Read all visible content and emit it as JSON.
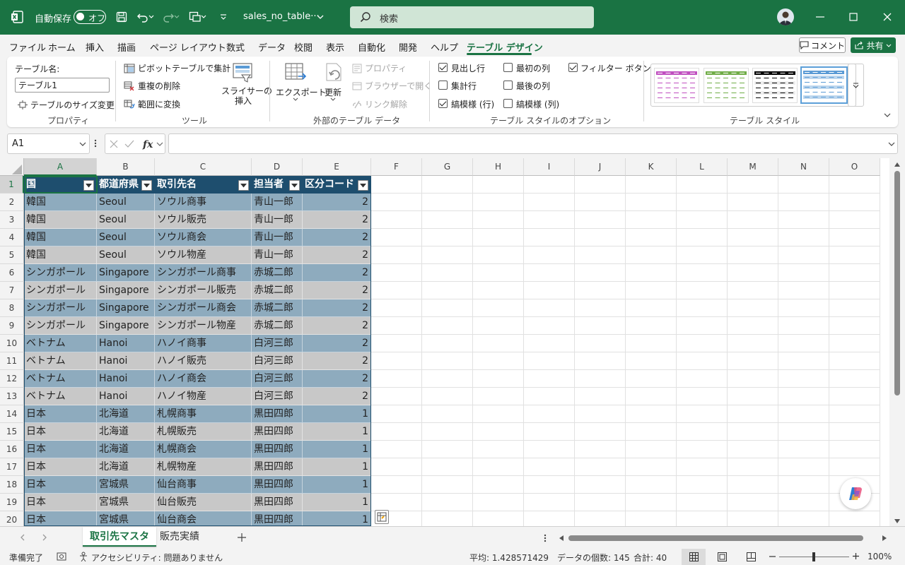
{
  "titlebar": {
    "autosave_label": "自動保存",
    "autosave_state": "オフ",
    "filename": "sales_no_table···",
    "search_placeholder": "検索"
  },
  "menu": [
    "ファイル",
    "ホーム",
    "挿入",
    "描画",
    "ページ レイアウト",
    "数式",
    "データ",
    "校閲",
    "表示",
    "自動化",
    "開発",
    "ヘルプ",
    "テーブル デザイン"
  ],
  "menu_active": "テーブル デザイン",
  "actions": {
    "comment": "コメント",
    "share": "共有"
  },
  "ribbon": {
    "table_name_label": "テーブル名:",
    "table_name_value": "テーブル1",
    "resize_table": "テーブルのサイズ変更",
    "group_properties": "プロパティ",
    "pivot_summary": "ピボットテーブルで集計",
    "remove_duplicates": "重複の削除",
    "convert_to_range": "範囲に変換",
    "slicer_line1": "スライサーの",
    "slicer_line2": "挿入",
    "group_tools": "ツール",
    "export": "エクスポート",
    "refresh": "更新",
    "properties": "プロパティ",
    "open_in_browser": "ブラウザーで開く",
    "unlink": "リンク解除",
    "group_external": "外部のテーブル データ",
    "opt_header_row": "見出し行",
    "opt_total_row": "集計行",
    "opt_banded_rows": "縞模様 (行)",
    "opt_first_column": "最初の列",
    "opt_last_column": "最後の列",
    "opt_banded_columns": "縞模様 (列)",
    "opt_filter_button": "フィルター ボタン",
    "opt_checked": {
      "header_row": true,
      "total_row": false,
      "banded_rows": true,
      "first_column": false,
      "last_column": false,
      "banded_columns": false,
      "filter_button": true
    },
    "group_style_options": "テーブル スタイルのオプション",
    "group_table_styles": "テーブル スタイル",
    "style_colors": [
      "#c04fc0",
      "#70ad47",
      "#000000",
      "#5b9bd5"
    ]
  },
  "formula_bar": {
    "name_box": "A1",
    "formula": ""
  },
  "columns": [
    "A",
    "B",
    "C",
    "D",
    "E",
    "F",
    "G",
    "H",
    "I",
    "J",
    "K",
    "L",
    "M",
    "N",
    "O"
  ],
  "row_numbers": [
    "1",
    "2",
    "3",
    "4",
    "5",
    "6",
    "7",
    "8",
    "9",
    "10",
    "11",
    "12",
    "13",
    "14",
    "15",
    "16",
    "17",
    "18",
    "19",
    "20"
  ],
  "table": {
    "headers": [
      "国",
      "都道府県",
      "取引先名",
      "担当者",
      "区分コード"
    ],
    "rows": [
      [
        "韓国",
        "Seoul",
        "ソウル商事",
        "青山一郎",
        "2"
      ],
      [
        "韓国",
        "Seoul",
        "ソウル販売",
        "青山一郎",
        "2"
      ],
      [
        "韓国",
        "Seoul",
        "ソウル商会",
        "青山一郎",
        "2"
      ],
      [
        "韓国",
        "Seoul",
        "ソウル物産",
        "青山一郎",
        "2"
      ],
      [
        "シンガポール",
        "Singapore",
        "シンガポール商事",
        "赤城二郎",
        "2"
      ],
      [
        "シンガポール",
        "Singapore",
        "シンガポール販売",
        "赤城二郎",
        "2"
      ],
      [
        "シンガポール",
        "Singapore",
        "シンガポール商会",
        "赤城二郎",
        "2"
      ],
      [
        "シンガポール",
        "Singapore",
        "シンガポール物産",
        "赤城二郎",
        "2"
      ],
      [
        "ベトナム",
        "Hanoi",
        "ハノイ商事",
        "白河三郎",
        "2"
      ],
      [
        "ベトナム",
        "Hanoi",
        "ハノイ販売",
        "白河三郎",
        "2"
      ],
      [
        "ベトナム",
        "Hanoi",
        "ハノイ商会",
        "白河三郎",
        "2"
      ],
      [
        "ベトナム",
        "Hanoi",
        "ハノイ物産",
        "白河三郎",
        "2"
      ],
      [
        "日本",
        "北海道",
        "札幌商事",
        "黒田四郎",
        "1"
      ],
      [
        "日本",
        "北海道",
        "札幌販売",
        "黒田四郎",
        "1"
      ],
      [
        "日本",
        "北海道",
        "札幌商会",
        "黒田四郎",
        "1"
      ],
      [
        "日本",
        "北海道",
        "札幌物産",
        "黒田四郎",
        "1"
      ],
      [
        "日本",
        "宮城県",
        "仙台商事",
        "黒田四郎",
        "1"
      ],
      [
        "日本",
        "宮城県",
        "仙台販売",
        "黒田四郎",
        "1"
      ],
      [
        "日本",
        "宮城県",
        "仙台商会",
        "黒田四郎",
        "1"
      ]
    ]
  },
  "sheets": [
    "取引先マスタ",
    "販売実績"
  ],
  "active_sheet": "取引先マスタ",
  "status": {
    "ready": "準備完了",
    "accessibility": "アクセシビリティ: 問題ありません",
    "average": "平均: 1.428571429",
    "count": "データの個数: 145",
    "sum": "合計: 40",
    "zoom": "100%"
  },
  "accent_color": "#1a7343"
}
